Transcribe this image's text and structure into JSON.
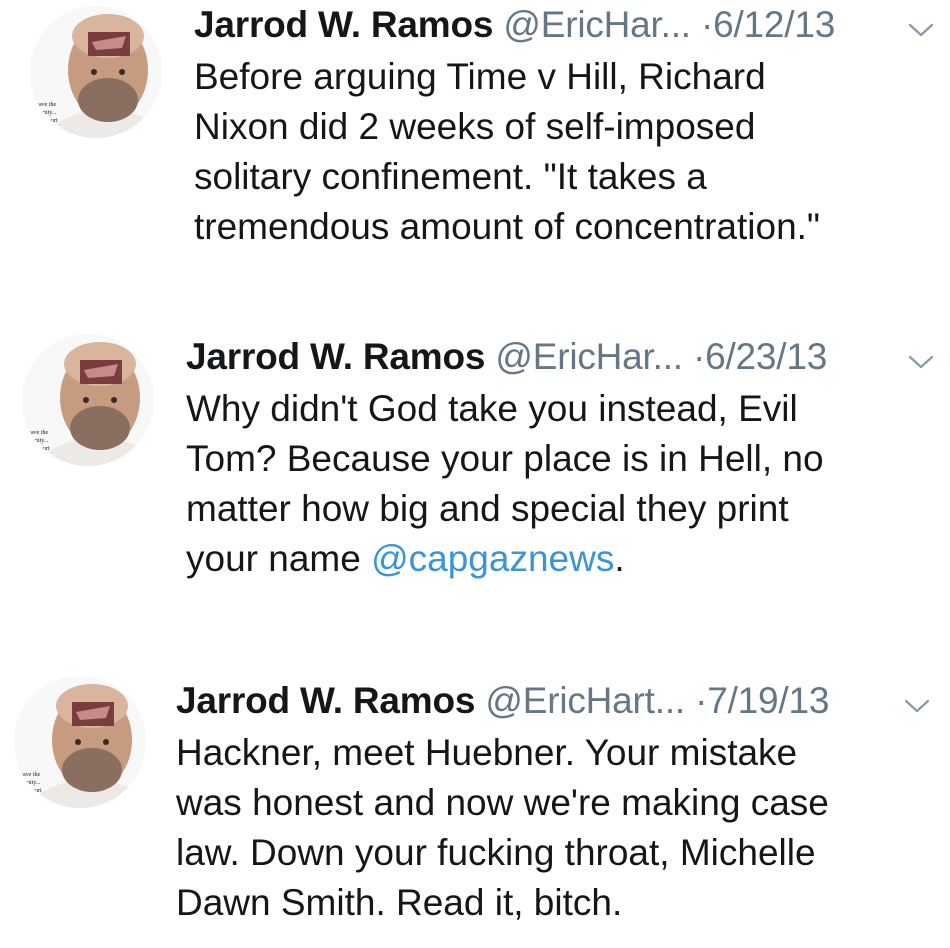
{
  "tweets": [
    {
      "name": "Jarrod W. Ramos",
      "handle": "@EricHar...",
      "date": "6/12/13",
      "text": "Before arguing Time v Hill, Richard\nNixon did 2 weeks of self-imposed\nsolitary confinement. \"It takes a\ntremendous amount of concentration.\"",
      "mention": "",
      "after_mention": ""
    },
    {
      "name": "Jarrod W. Ramos",
      "handle": "@EricHar...",
      "date": "6/23/13",
      "text": "Why didn't God take you instead, Evil\nTom? Because your place is in Hell, no\nmatter how big and special they print\nyour name ",
      "mention": "@capgaznews",
      "after_mention": "."
    },
    {
      "name": "Jarrod W. Ramos",
      "handle": "@EricHart...",
      "date": "7/19/13",
      "text": "Hackner, meet Huebner. Your mistake\nwas honest and now we're making case\nlaw. Down your fucking throat, Michelle\nDawn Smith. Read it, bitch.",
      "mention": "",
      "after_mention": ""
    }
  ],
  "separator": "·",
  "avatar_caption": [
    "have the",
    "unity...",
    "Court"
  ],
  "icons": {
    "avatar": "profile-photo",
    "chevron": "chevron-down-icon"
  },
  "colors": {
    "text": "#14171a",
    "secondary": "#657786",
    "link": "#3b94d9"
  }
}
